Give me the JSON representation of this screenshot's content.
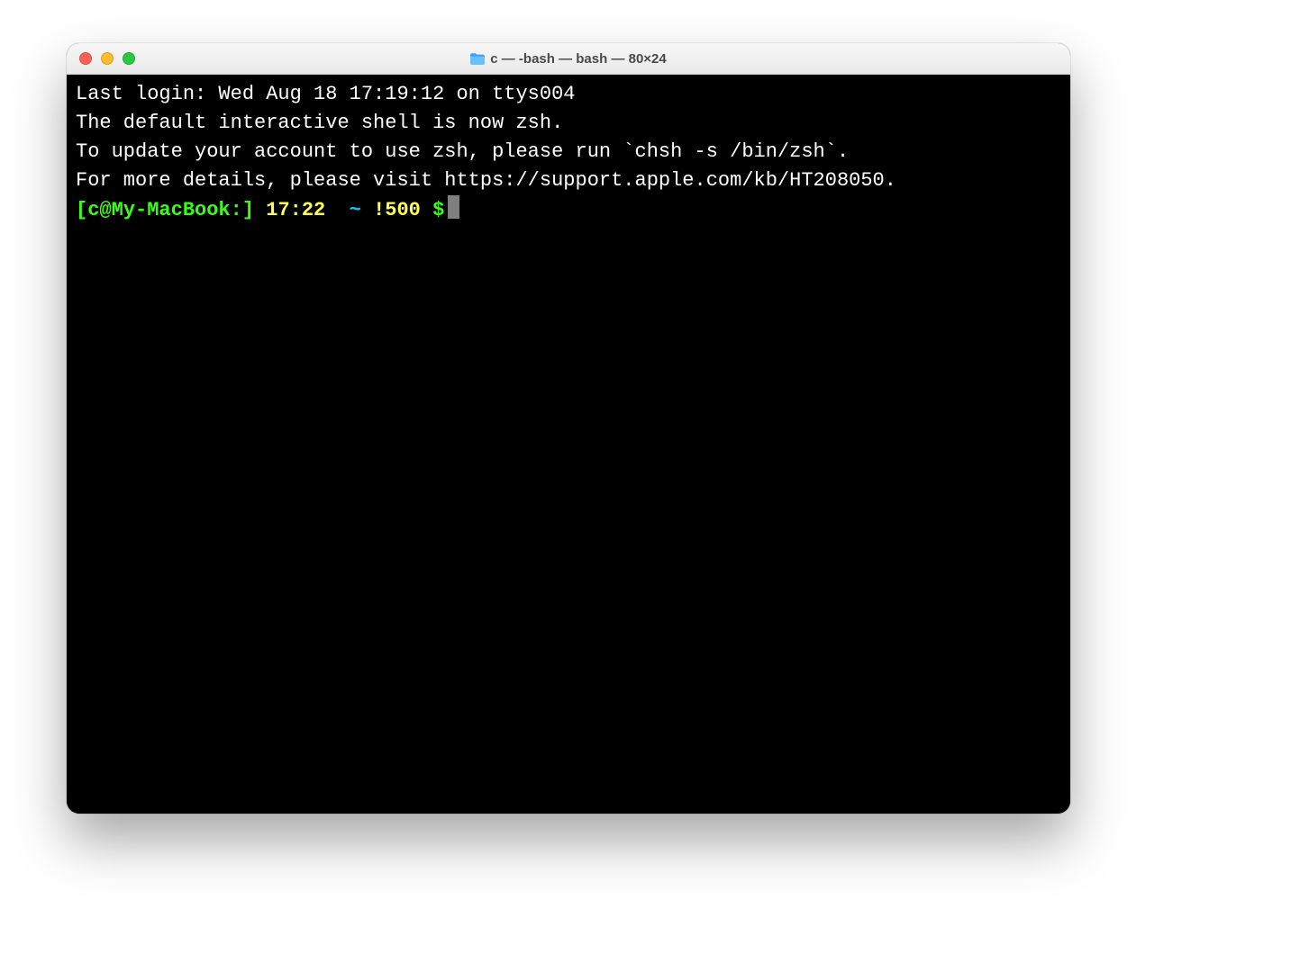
{
  "window": {
    "title": "c — -bash — bash — 80×24"
  },
  "terminal": {
    "line_last_login": "Last login: Wed Aug 18 17:19:12 on ttys004",
    "line_blank": "",
    "line_zsh1": "The default interactive shell is now zsh.",
    "line_zsh2": "To update your account to use zsh, please run `chsh -s /bin/zsh`.",
    "line_zsh3": "For more details, please visit https://support.apple.com/kb/HT208050.",
    "prompt": {
      "user_host": "[c@My-MacBook:]",
      "time": "17:22",
      "cwd": "~",
      "history": "!500",
      "sigil": "$"
    }
  }
}
